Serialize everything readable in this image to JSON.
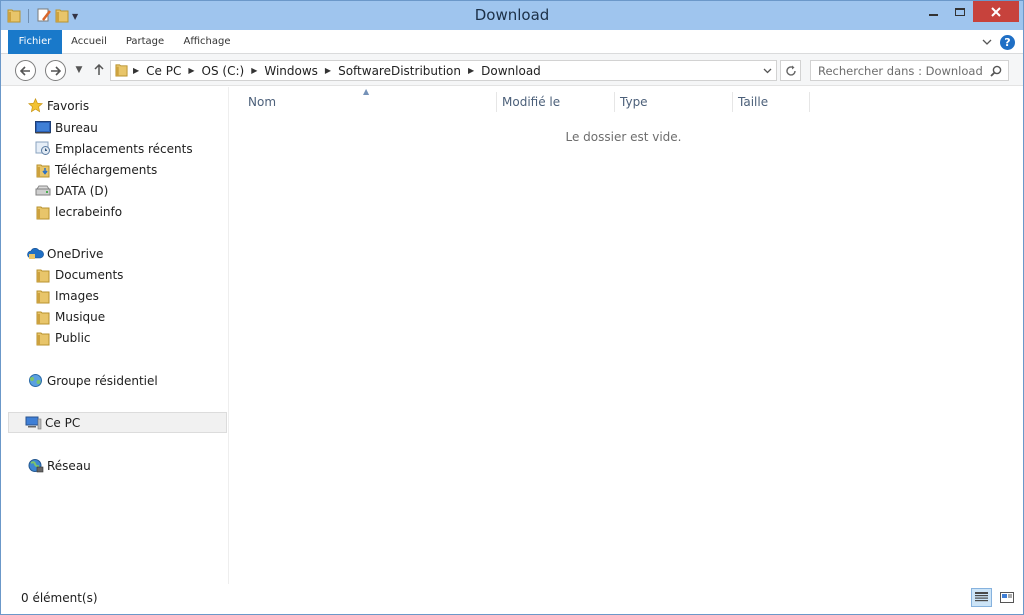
{
  "window": {
    "title": "Download"
  },
  "ribbon": {
    "tabs": [
      "Fichier",
      "Accueil",
      "Partage",
      "Affichage"
    ],
    "help_label": "?"
  },
  "address": {
    "crumbs": [
      "Ce PC",
      "OS (C:)",
      "Windows",
      "SoftwareDistribution",
      "Download"
    ]
  },
  "search": {
    "placeholder": "Rechercher dans : Download"
  },
  "navpane": {
    "favorites": {
      "label": "Favoris",
      "items": [
        "Bureau",
        "Emplacements récents",
        "Téléchargements",
        "DATA (D)",
        "lecrabeinfo"
      ]
    },
    "onedrive": {
      "label": "OneDrive",
      "items": [
        "Documents",
        "Images",
        "Musique",
        "Public"
      ]
    },
    "homegroup": {
      "label": "Groupe résidentiel"
    },
    "thispc": {
      "label": "Ce PC"
    },
    "network": {
      "label": "Réseau"
    }
  },
  "columns": [
    "Nom",
    "Modifié le",
    "Type",
    "Taille"
  ],
  "content": {
    "empty_message": "Le dossier est vide."
  },
  "status": {
    "count": "0 élément(s)"
  },
  "colors": {
    "titlebar": "#9fc5ee",
    "file_tab": "#1979ca",
    "close_button": "#c7423c",
    "folder": "#e8c56a"
  },
  "icons": {
    "qat": [
      "folder-icon",
      "properties-icon",
      "new-folder-icon",
      "customize-arrow-icon"
    ],
    "window": [
      "minimize-icon",
      "maximize-icon",
      "close-icon"
    ]
  }
}
